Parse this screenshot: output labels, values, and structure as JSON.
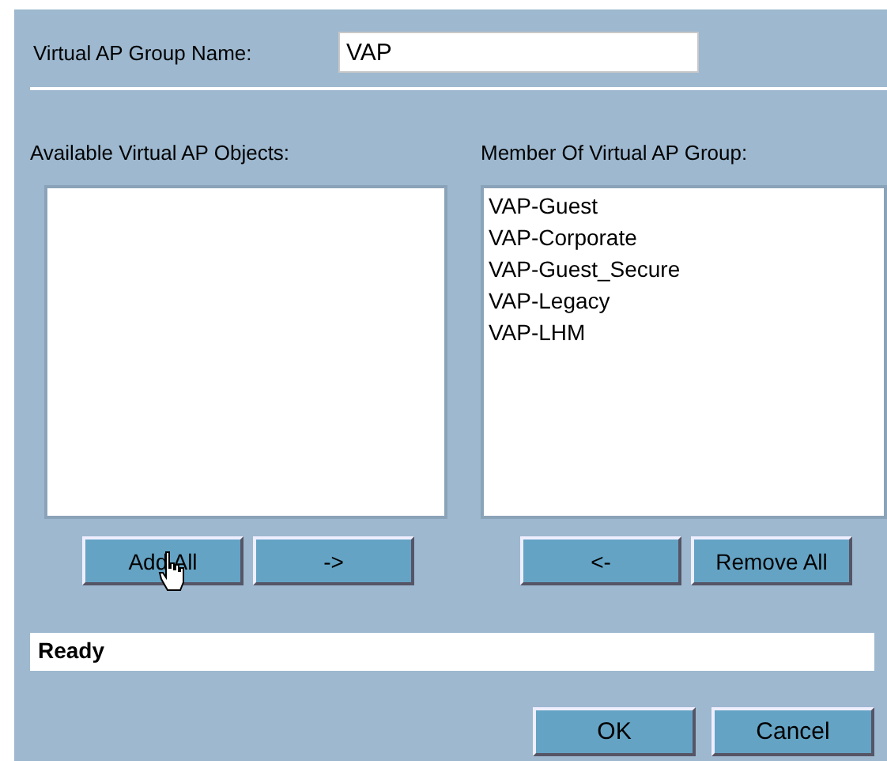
{
  "group_name": {
    "label": "Virtual AP Group Name:",
    "value": "VAP"
  },
  "available": {
    "label": "Available Virtual AP Objects:"
  },
  "members": {
    "label": "Member Of Virtual AP Group:",
    "items": [
      "VAP-Guest",
      "VAP-Corporate",
      "VAP-Guest_Secure",
      "VAP-Legacy",
      "VAP-LHM"
    ]
  },
  "left_buttons": [
    "Add All",
    "->"
  ],
  "right_buttons": [
    "<-",
    "Remove All"
  ],
  "status": "Ready",
  "buttons": [
    "OK",
    "Cancel"
  ]
}
